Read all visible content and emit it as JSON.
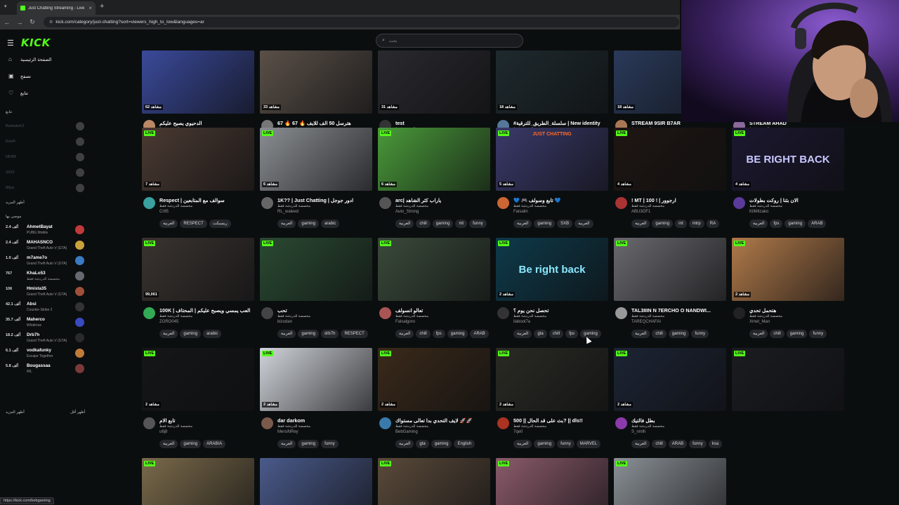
{
  "browser": {
    "tab_title": "Just Chatting Streaming - Live",
    "url": "kick.com/category/just-chatting?sort=viewers_high_to_low&languages=ar",
    "status_url": "https://kick.com/bebgaming"
  },
  "sidebar": {
    "logo": "KICK",
    "nav": [
      {
        "label": "الصفحة الرئيسية",
        "icon": "home-icon"
      },
      {
        "label": "تصفح",
        "icon": "browse-icon"
      },
      {
        "label": "تتابع",
        "icon": "heart-icon"
      }
    ],
    "following_title": "تتابع",
    "followed_offline": [
      "Badraksh2",
      "RzH4",
      "NFRR",
      "3Z02",
      "iBlya"
    ],
    "followed_more": "أظهر المزيد",
    "recommended_title": "موصى بها",
    "recommended": [
      {
        "name": "AhmetBayat",
        "game": "PUBG Mobile",
        "viewers": "2.4 ألف",
        "color": "#c03a3a"
      },
      {
        "name": "MAHASNCO",
        "game": "Grand Theft Auto V (GTA)",
        "viewers": "2.4 ألف",
        "color": "#c9a33a"
      },
      {
        "name": "m7ame7o",
        "game": "Grand Theft Auto V (GTA)",
        "viewers": "1.0 ألف",
        "color": "#3a7ac0"
      },
      {
        "name": "KhaLo53",
        "game": "مخصصة للدردشة فقط",
        "viewers": "767",
        "color": "#666a70"
      },
      {
        "name": "Hmista35",
        "game": "Grand Theft Auto V (GTA)",
        "viewers": "106",
        "color": "#a0503a"
      },
      {
        "name": "Absi",
        "game": "Counter-Strike 2",
        "viewers": "42.1 ألف",
        "color": "#333333"
      },
      {
        "name": "Maherco",
        "game": "Windrose",
        "viewers": "35.7 ألف",
        "color": "#3a4ac0"
      },
      {
        "name": "Drb7h",
        "game": "Grand Theft Auto V (GTA)",
        "viewers": "18.2 ألف",
        "color": "#2a2a2a"
      },
      {
        "name": "vodkafunky",
        "game": "Escape Together",
        "viewers": "6.1 ألف",
        "color": "#c07a3a"
      },
      {
        "name": "Bougassaa",
        "game": "IRL",
        "viewers": "5.8 ألف",
        "color": "#7a3a3a"
      }
    ],
    "more_left": "أظهر المزيد",
    "more_right": "أظهر أقل"
  },
  "search": {
    "placeholder": "بحث"
  },
  "cards": [
    {
      "title": "الدحيوي يصيح عليكم",
      "user": "maaja1",
      "category": "مخصصة للدردشة فقط",
      "viewers": "62 مشاهد",
      "tags": [
        "العربية",
        "gaming",
        "ARAB",
        "chat"
      ],
      "color": "#3a4a9a",
      "avatar": "#bb8866"
    },
    {
      "title": "67 🔥 هترسل 50 الف للايف 🔥 67",
      "user": "SelfHegazy",
      "category": "مخصصة للدردشة فقط",
      "viewers": "33 مشاهد",
      "tags": [
        "العربية"
      ],
      "color": "#5a5048",
      "avatar": "#777777"
    },
    {
      "title": "test",
      "user": "2oxu",
      "category": "مخصصة للدردشة فقط",
      "viewers": "31 مشاهد",
      "tags": [
        "العربية"
      ],
      "color": "#2a2a2e",
      "avatar": "#333333"
    },
    {
      "title": "#سلسلة_الطريق_للترقية | New identity",
      "user": "IAS18",
      "category": "مخصصة للدردشة فقط",
      "viewers": "18 مشاهد",
      "tags": [
        "العربية",
        "gaming",
        "saudiArabia"
      ],
      "color": "#1e2a2e",
      "avatar": "#557799"
    },
    {
      "title": "STREAM 9SIR B7AR",
      "user": "Soussi000",
      "category": "مخصصة للدردشة فقط",
      "viewers": "18 مشاهد",
      "tags": [
        "العربية",
        "morocco"
      ],
      "color": "#2a3a5a",
      "avatar": "#aa7755"
    },
    {
      "title": "STREAM AHAD",
      "user": "joeeXVII",
      "category": "مخصصة للدردشة فقط",
      "viewers": "7 مشاهد",
      "tags": [
        "العربية",
        "TUNISIA",
        "tunisie",
        "English"
      ],
      "color": "#a07a5a",
      "avatar": "#8a6a9a",
      "live": "LIVE"
    },
    {
      "title": "Respect | سوالف مع المتابعين",
      "user": "Cr85",
      "category": "مخصصة للدردشة فقط",
      "viewers": "7 مشاهد",
      "tags": [
        "العربية",
        "RESPECT",
        "ريسبكت"
      ],
      "color": "#4a3a32",
      "avatar": "#3aa0a0",
      "live": "LIVE"
    },
    {
      "title": "1K?? | Just Chatting | ادور جوجل",
      "user": "RL_waleed",
      "category": "مخصصة للدردشة فقط",
      "viewers": "6 مشاهد",
      "tags": [
        "العربية",
        "gaming",
        "arabic"
      ],
      "color": "#8a8e92",
      "avatar": "#666666",
      "live": "LIVE"
    },
    {
      "title": "arc| ياراب كثر الشاهد",
      "user": "Auto_Strong",
      "category": "مخصصة للدردشة فقط",
      "viewers": "6 مشاهد",
      "tags": [
        "العربية",
        "chill",
        "gaming",
        "mt",
        "funny"
      ],
      "color": "#4a9a3a",
      "avatar": "#555555",
      "live": "LIVE"
    },
    {
      "title": "💙 🎮 تابع وسولف 💙",
      "user": "Faisalin",
      "category": "مخصصة للدردشة فقط",
      "viewers": "5 مشاهد",
      "tags": [
        "العربية",
        "gaming",
        "SXB",
        "العربية"
      ],
      "color": "#3a3a6a",
      "avatar": "#cc6633",
      "live": "LIVE",
      "overlay": "JUST CHATTING",
      "ovcolor": "#ff6a2a"
    },
    {
      "title": "! MT | 100 ! | ارجوور",
      "user": "ABU3OF1",
      "category": "مخصصة للدردشة فقط",
      "viewers": "4 مشاهد",
      "tags": [
        "العربية",
        "gaming",
        "mt",
        "mtrp",
        "RA"
      ],
      "color": "#1e1612",
      "avatar": "#aa3333",
      "live": "LIVE"
    },
    {
      "title": "الان بثنا | روكت بطولات",
      "user": "KilMitzako",
      "category": "مخصصة للدردشة فقط",
      "viewers": "4 مشاهد",
      "tags": [
        "العربية",
        "fps",
        "gaming",
        "ARAB"
      ],
      "color": "#1c1830",
      "avatar": "#5a3a9a",
      "live": "LIVE",
      "overlay": "BE RIGHT BACK",
      "ovcolor": "#c8c8ff"
    },
    {
      "title": "100K | العب يمسي ويصبح عليكم | المحتاف",
      "user": "ZORO045",
      "category": "مخصصة للدردشة فقط",
      "viewers": "99,061",
      "tags": [
        "العربية",
        "gaming",
        "arabic"
      ],
      "color": "#3a3430",
      "avatar": "#33aa55",
      "live": "LIVE"
    },
    {
      "title": "تحب",
      "user": "bizodan",
      "category": "مخصصة للدردشة فقط",
      "viewers": "",
      "tags": [
        "العربية",
        "gaming",
        "drb7h",
        "RESPECT"
      ],
      "color": "#2a4a32",
      "avatar": "#444444",
      "live": "LIVE"
    },
    {
      "title": "تعالو انسولف",
      "user": "Falsalgoro",
      "category": "مخصصة للدردشة فقط",
      "viewers": "",
      "tags": [
        "العربية",
        "chill",
        "fps",
        "gaming",
        "ARAB"
      ],
      "color": "#3a4a3a",
      "avatar": "#aa5555",
      "live": "LIVE"
    },
    {
      "title": "تحصل نحن يوم ؟",
      "user": "ilabool7a",
      "category": "مخصصة للدردشة فقط",
      "viewers": "2 مشاهد",
      "tags": [
        "العربية",
        "gta",
        "chill",
        "fps",
        "gaming"
      ],
      "color": "#0e3a4a",
      "avatar": "#333333",
      "live": "LIVE",
      "overlay": "Be right back",
      "ovcolor": "#8ae8ff"
    },
    {
      "title": "TAL3IIIN N 7ERCHO O NANDWI...",
      "user": "TAREQCHAFAI",
      "category": "مخصصة للدردشة فقط",
      "viewers": "",
      "tags": [
        "العربية",
        "chill",
        "gaming",
        "funny"
      ],
      "color": "#6a6a6e",
      "avatar": "#999999",
      "live": "LIVE"
    },
    {
      "title": "هتحمل تحدي",
      "user": "Xmet_Man",
      "category": "مخصصة للدردشة فقط",
      "viewers": "2 مشاهد",
      "tags": [
        "العربية",
        "chill",
        "gaming",
        "funny"
      ],
      "color": "#b07a4a",
      "avatar": "#222222",
      "live": "LIVE"
    },
    {
      "title": "تابع الام",
      "user": "u6j8",
      "category": "مخصصة للدردشة فقط",
      "viewers": "2 مشاهد",
      "tags": [
        "العربية",
        "gaming",
        "ARABIA"
      ],
      "color": "#141618",
      "avatar": "#555555",
      "live": "LIVE"
    },
    {
      "title": "dar darkom",
      "user": "MersiNRey",
      "category": "مخصصة للدردشة فقط",
      "viewers": "2 مشاهد",
      "tags": [
        "العربية",
        "gaming",
        "funny"
      ],
      "color": "#d0d4da",
      "avatar": "#7a5a4a",
      "live": "LIVE"
    },
    {
      "title": "لايف التحدي بدا تعالى مستواك 🚀🚀",
      "user": "BebGaming",
      "category": "مخصصة للدردشة فقط",
      "viewers": "2 مشاهد",
      "tags": [
        "العربية",
        "gta",
        "gaming",
        "English"
      ],
      "color": "#3a2a1a",
      "avatar": "#3a7aaa",
      "live": "LIVE"
    },
    {
      "title": "بث على قد الحال || 500? || dls!!",
      "user": "7qe0",
      "category": "مخصصة للدردشة فقط",
      "viewers": "2 مشاهد",
      "tags": [
        "العربية",
        "gaming",
        "funny",
        "MARVEL"
      ],
      "color": "#2a2a24",
      "avatar": "#aa3322",
      "live": "LIVE"
    },
    {
      "title": "بطل فالتيك",
      "user": "S_nmlh",
      "category": "مخصصة للدردشة فقط",
      "viewers": "2 مشاهد",
      "tags": [
        "العربية",
        "chill",
        "ARAB",
        "funny",
        "ksa"
      ],
      "color": "#1c2434",
      "avatar": "#8a3aaa",
      "live": "LIVE"
    },
    {
      "title": "",
      "user": "",
      "category": "",
      "viewers": "",
      "tags": [],
      "color": "#1a1c20",
      "avatar": "#000000",
      "live": "LIVE"
    },
    {
      "title": "",
      "user": "",
      "category": "",
      "viewers": "",
      "tags": [],
      "color": "#7a6a4a",
      "avatar": "#000000",
      "live": "LIVE"
    },
    {
      "title": "",
      "user": "",
      "category": "",
      "viewers": "",
      "tags": [],
      "color": "#4a5a8a",
      "avatar": "#000000",
      "live": ""
    },
    {
      "title": "",
      "user": "",
      "category": "",
      "viewers": "",
      "tags": [],
      "color": "#5a4a3a",
      "avatar": "#000000",
      "live": "LIVE"
    },
    {
      "title": "",
      "user": "",
      "category": "",
      "viewers": "",
      "tags": [],
      "color": "#8a5a6a",
      "avatar": "#000000",
      "live": "LIVE"
    },
    {
      "title": "",
      "user": "",
      "category": "",
      "viewers": "",
      "tags": [],
      "color": "#8a9096",
      "avatar": "#000000",
      "live": "LIVE"
    }
  ],
  "colors": {
    "brand": "#53fc18",
    "background": "#0b0e0f",
    "tag_bg": "#24272b"
  }
}
